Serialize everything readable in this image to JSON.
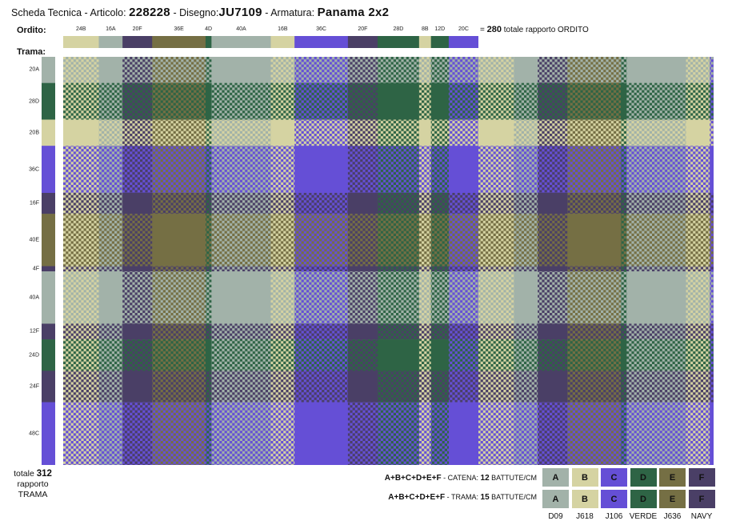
{
  "header": {
    "prefix": "Scheda Tecnica - Articolo:",
    "articolo": "228228",
    "disegno_label": "- Disegno:",
    "disegno": "JU7109",
    "armatura_label": "- Armatura:",
    "armatura": "Panama 2x2"
  },
  "labels": {
    "ordito": "Ordito:",
    "trama": "Trama:"
  },
  "warp_summary": {
    "prefix": "=",
    "total": "280",
    "suffix": "totale rapporto ORDITO"
  },
  "weft_summary": {
    "prefix": "totale",
    "total": "312",
    "line2": "rapporto",
    "line3": "TRAMA"
  },
  "colors": {
    "A": "#a2b2a9",
    "B": "#d5d3a2",
    "C": "#654fd6",
    "D": "#2e6445",
    "E": "#756f44",
    "F": "#4a3f66"
  },
  "warp": [
    {
      "code": "24B",
      "color": "B",
      "count": 24
    },
    {
      "code": "16A",
      "color": "A",
      "count": 16
    },
    {
      "code": "20F",
      "color": "F",
      "count": 20
    },
    {
      "code": "36E",
      "color": "E",
      "count": 36
    },
    {
      "code": "4D",
      "color": "D",
      "count": 4
    },
    {
      "code": "40A",
      "color": "A",
      "count": 40
    },
    {
      "code": "16B",
      "color": "B",
      "count": 16
    },
    {
      "code": "36C",
      "color": "C",
      "count": 36
    },
    {
      "code": "20F",
      "color": "F",
      "count": 20
    },
    {
      "code": "28D",
      "color": "D",
      "count": 28
    },
    {
      "code": "8B",
      "color": "B",
      "count": 8
    },
    {
      "code": "12D",
      "color": "D",
      "count": 12
    },
    {
      "code": "20C",
      "color": "C",
      "count": 20
    }
  ],
  "weft": [
    {
      "code": "20A",
      "color": "A",
      "count": 20
    },
    {
      "code": "28D",
      "color": "D",
      "count": 28
    },
    {
      "code": "20B",
      "color": "B",
      "count": 20
    },
    {
      "code": "36C",
      "color": "C",
      "count": 36
    },
    {
      "code": "16F",
      "color": "F",
      "count": 16
    },
    {
      "code": "40E",
      "color": "E",
      "count": 40
    },
    {
      "code": "4F",
      "color": "F",
      "count": 4
    },
    {
      "code": "40A",
      "color": "A",
      "count": 40
    },
    {
      "code": "12F",
      "color": "F",
      "count": 12
    },
    {
      "code": "24D",
      "color": "D",
      "count": 24
    },
    {
      "code": "24F",
      "color": "F",
      "count": 24
    },
    {
      "code": "48C",
      "color": "C",
      "count": 48
    }
  ],
  "spec": {
    "catena_formula": "A+B+C+D+E+F",
    "catena_label": "- CATENA:",
    "catena_value": "12",
    "catena_unit": "BATTUTE/CM",
    "trama_formula": "A+B+C+D+E+F",
    "trama_label": "- TRAMA:",
    "trama_value": "15",
    "trama_unit": "BATTUTE/CM"
  },
  "yarns": [
    {
      "letter": "A",
      "name": "D09"
    },
    {
      "letter": "B",
      "name": "J618"
    },
    {
      "letter": "C",
      "name": "J106"
    },
    {
      "letter": "D",
      "name": "VERDE"
    },
    {
      "letter": "E",
      "name": "J636"
    },
    {
      "letter": "F",
      "name": "NAVY"
    }
  ],
  "swatch_rows": [
    "catena",
    "trama"
  ]
}
